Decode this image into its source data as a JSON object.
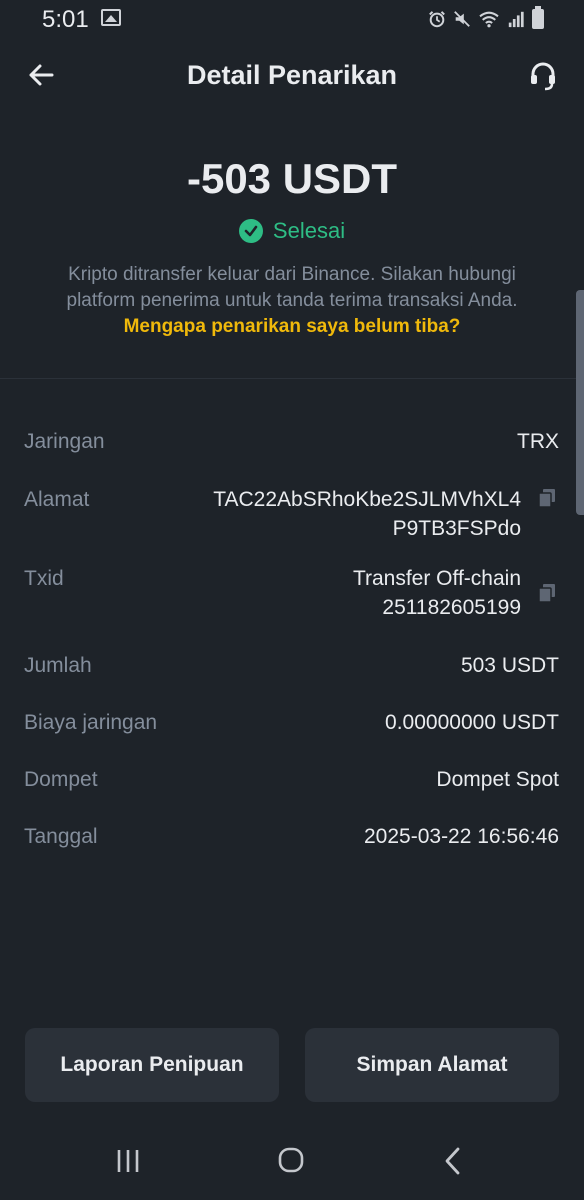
{
  "status_bar": {
    "time": "5:01",
    "icons": [
      "image-icon",
      "alarm-icon",
      "mute-icon",
      "wifi-icon",
      "signal-icon",
      "battery-icon"
    ]
  },
  "header": {
    "title": "Detail Penarikan",
    "back_icon": "arrow-left-icon",
    "support_icon": "headset-icon"
  },
  "summary": {
    "amount": "-503 USDT",
    "status": "Selesai",
    "status_color": "#2ebd85",
    "description": "Kripto ditransfer keluar dari Binance. Silakan hubungi platform penerima untuk tanda terima transaksi Anda.",
    "help_link": "Mengapa penarikan saya belum tiba?",
    "link_color": "#f0b90b"
  },
  "details": [
    {
      "label": "Jaringan",
      "value": "TRX"
    },
    {
      "label": "Alamat",
      "value_line1": "TAC22AbSRhoKbe2SJLMVhXL4",
      "value_line2": "P9TB3FSPdo",
      "copyable": true
    },
    {
      "label": "Txid",
      "value_line1": "Transfer Off-chain",
      "value_line2": "251182605199",
      "copyable": true
    },
    {
      "label": "Jumlah",
      "value": "503 USDT"
    },
    {
      "label": "Biaya jaringan",
      "value": "0.00000000 USDT"
    },
    {
      "label": "Dompet",
      "value": "Dompet Spot"
    },
    {
      "label": "Tanggal",
      "value": "2025-03-22 16:56:46"
    }
  ],
  "buttons": {
    "report": "Laporan Penipuan",
    "save_address": "Simpan Alamat"
  },
  "nav_bar": [
    "recent-apps-icon",
    "home-icon",
    "back-icon"
  ],
  "colors": {
    "background": "#1e2329",
    "surface": "#2b3139",
    "muted_text": "#848e9c"
  }
}
